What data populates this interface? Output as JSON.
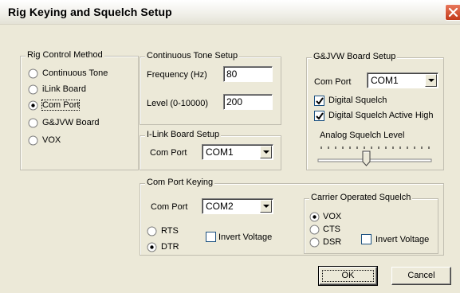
{
  "window": {
    "title": "Rig Keying and Squelch Setup"
  },
  "rig_control": {
    "label": "Rig Control Method",
    "options": [
      "Continuous Tone",
      "iLink Board",
      "Com Port",
      "G&JVW Board",
      "VOX"
    ],
    "selected": "Com Port"
  },
  "continuous_tone": {
    "label": "Continuous Tone Setup",
    "frequency_label": "Frequency (Hz)",
    "frequency_value": "80",
    "level_label": "Level (0-10000)",
    "level_value": "200"
  },
  "ilink": {
    "label": "I-Link Board Setup",
    "com_port_label": "Com Port",
    "com_port_value": "COM1"
  },
  "gjvw": {
    "label": "G&JVW Board Setup",
    "com_port_label": "Com Port",
    "com_port_value": "COM1",
    "digital_squelch_label": "Digital Squelch",
    "digital_squelch_checked": true,
    "active_high_label": "Digital Squelch Active High",
    "active_high_checked": true,
    "analog_level_label": "Analog Squelch Level",
    "analog_level_fraction": 0.4
  },
  "com_port_keying": {
    "label": "Com Port Keying",
    "com_port_label": "Com Port",
    "com_port_value": "COM2",
    "rts_label": "RTS",
    "dtr_label": "DTR",
    "selected": "DTR",
    "invert_label": "Invert Voltage",
    "invert_checked": false
  },
  "cos": {
    "label": "Carrier Operated Squelch",
    "vox_label": "VOX",
    "cts_label": "CTS",
    "dsr_label": "DSR",
    "selected": "VOX",
    "invert_label": "Invert Voltage",
    "invert_checked": false
  },
  "buttons": {
    "ok": "OK",
    "cancel": "Cancel"
  }
}
